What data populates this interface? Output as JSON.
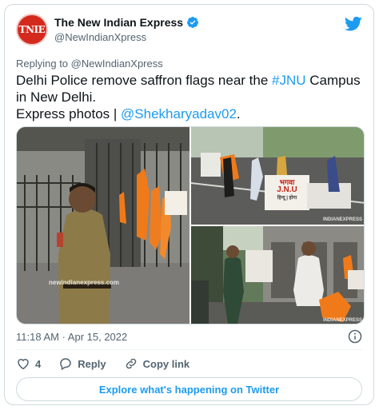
{
  "account": {
    "name": "The New Indian Express",
    "handle": "@NewIndianXpress",
    "avatar_text": "TNIE"
  },
  "reply": {
    "prefix": "Replying to ",
    "handle": "@NewIndianXpress"
  },
  "tweet": {
    "line1_a": "Delhi Police remove saffron flags near the ",
    "hashtag": "#JNU",
    "line1_b": " Campus in New Delhi.",
    "line2_a": "Express photos | ",
    "mention": "@Shekharyadav02",
    "line2_b": "."
  },
  "photos": {
    "watermark1": "newindianexpress.com",
    "watermark2": "INDIANEXPRESS",
    "watermark3": "INDIANEXPRESS",
    "banner_line1": "भगवा",
    "banner_line2": "J.N.U",
    "banner_line3": "हिन्दू | होगा"
  },
  "timestamp": "11:18 AM · Apr 15, 2022",
  "actions": {
    "likes": "4",
    "reply_label": "Reply",
    "copy_label": "Copy link"
  },
  "explore_label": "Explore what's happening on Twitter",
  "colors": {
    "accent": "#1d9bf0",
    "secondary_text": "#536471",
    "saffron": "#f07a1a"
  }
}
